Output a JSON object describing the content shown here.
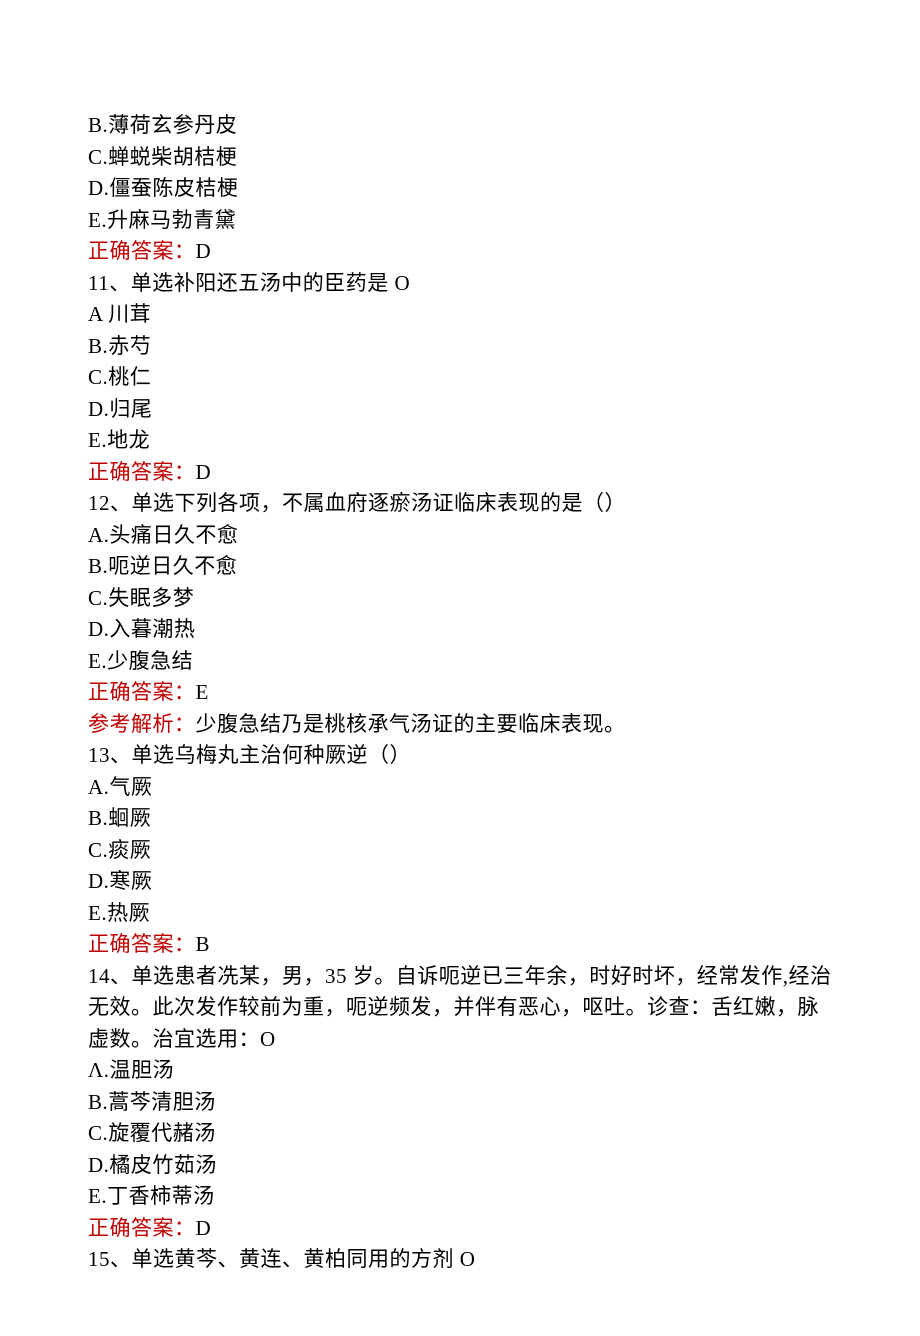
{
  "lines": [
    {
      "type": "text",
      "content": "B.薄荷玄参丹皮"
    },
    {
      "type": "text",
      "content": "C.蝉蜕柴胡桔梗"
    },
    {
      "type": "text",
      "content": "D.僵蚕陈皮桔梗"
    },
    {
      "type": "text",
      "content": "E.升麻马勃青黛"
    },
    {
      "type": "answer",
      "label": "正确答案：",
      "value": "D"
    },
    {
      "type": "text",
      "content": "11、单选补阳还五汤中的臣药是 O"
    },
    {
      "type": "text",
      "content": "A 川茸"
    },
    {
      "type": "text",
      "content": "B.赤芍"
    },
    {
      "type": "text",
      "content": "C.桃仁"
    },
    {
      "type": "text",
      "content": "D.归尾"
    },
    {
      "type": "text",
      "content": "E.地龙"
    },
    {
      "type": "answer",
      "label": "正确答案：",
      "value": "D"
    },
    {
      "type": "text",
      "content": "12、单选下列各项，不属血府逐瘀汤证临床表现的是（）"
    },
    {
      "type": "text",
      "content": "A.头痛日久不愈"
    },
    {
      "type": "text",
      "content": "B.呃逆日久不愈"
    },
    {
      "type": "text",
      "content": "C.失眠多梦"
    },
    {
      "type": "text",
      "content": "D.入暮潮热"
    },
    {
      "type": "text",
      "content": "E.少腹急结"
    },
    {
      "type": "answer",
      "label": "正确答案：",
      "value": "E"
    },
    {
      "type": "analysis",
      "label": "参考解析：",
      "value": "少腹急结乃是桃核承气汤证的主要临床表现。"
    },
    {
      "type": "text",
      "content": "13、单选乌梅丸主治何种厥逆（）"
    },
    {
      "type": "text",
      "content": "A.气厥"
    },
    {
      "type": "text",
      "content": "B.蛔厥"
    },
    {
      "type": "text",
      "content": "C.痰厥"
    },
    {
      "type": "text",
      "content": "D.寒厥"
    },
    {
      "type": "text",
      "content": "E.热厥"
    },
    {
      "type": "answer",
      "label": "正确答案：",
      "value": "B"
    },
    {
      "type": "text",
      "content": "14、单选患者冼某，男，35 岁。自诉呃逆已三年余，时好时坏，经常发作,经治无效。此次发作较前为重，呃逆频发，并伴有恶心，呕吐。诊查：舌红嫩，脉虚数。治宜选用：O"
    },
    {
      "type": "text",
      "content": "Λ.温胆汤"
    },
    {
      "type": "text",
      "content": "B.蒿芩清胆汤"
    },
    {
      "type": "text",
      "content": "C.旋覆代赭汤"
    },
    {
      "type": "text",
      "content": "D.橘皮竹茹汤"
    },
    {
      "type": "text",
      "content": "E.丁香柿蒂汤"
    },
    {
      "type": "answer",
      "label": "正确答案：",
      "value": "D"
    },
    {
      "type": "text",
      "content": "15、单选黄芩、黄连、黄柏同用的方剂 O"
    }
  ]
}
